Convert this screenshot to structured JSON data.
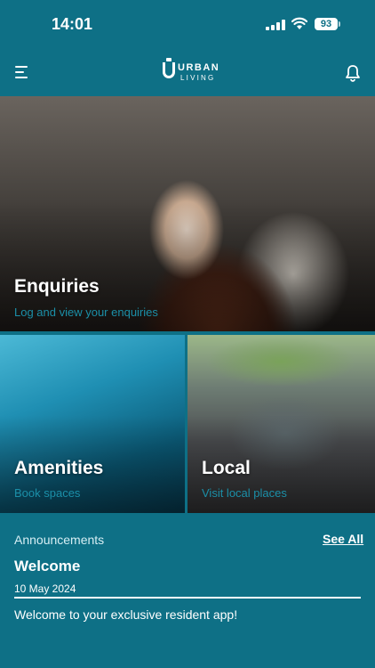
{
  "status_bar": {
    "time": "14:01",
    "battery": "93"
  },
  "header": {
    "logo_top": "URBAN",
    "logo_bottom": "LIVING"
  },
  "tiles": [
    {
      "title": "Enquiries",
      "subtitle": "Log and view your enquiries"
    },
    {
      "title": "Amenities",
      "subtitle": "Book spaces"
    },
    {
      "title": "Local",
      "subtitle": "Visit local places"
    }
  ],
  "announcements": {
    "section_title": "Announcements",
    "see_all": "See All",
    "items": [
      {
        "title": "Welcome",
        "date": "10 May 2024",
        "body": "Welcome to your exclusive resident app!"
      }
    ]
  },
  "colors": {
    "background": "#0e7086",
    "subtitle": "#1b8fa8",
    "text": "#ffffff"
  }
}
